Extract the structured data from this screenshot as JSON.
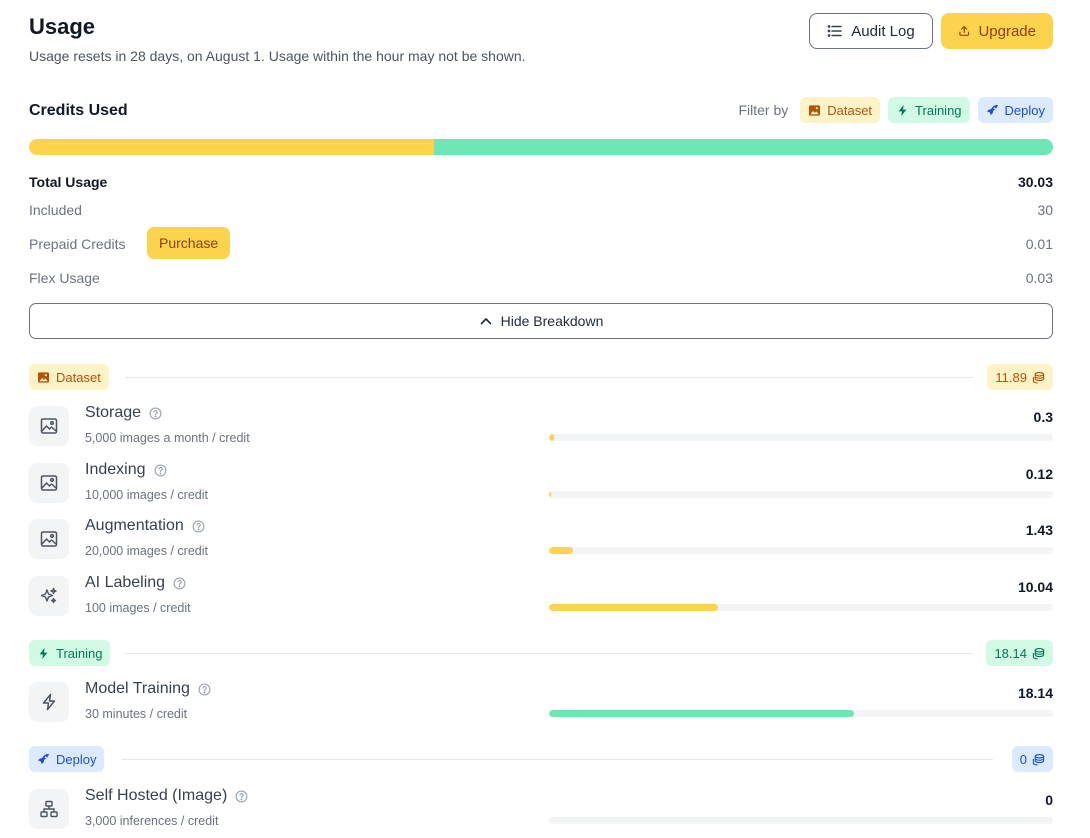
{
  "header": {
    "title": "Usage",
    "subtitle": "Usage resets in 28 days, on August 1. Usage within the hour may not be shown.",
    "audit_log_label": "Audit Log",
    "upgrade_label": "Upgrade"
  },
  "credits": {
    "title": "Credits Used",
    "filter_label": "Filter by",
    "filters": [
      "Dataset",
      "Training",
      "Deploy"
    ],
    "bar_segments": [
      {
        "category": "Dataset",
        "value": 11.89,
        "color": "#fcd34d"
      },
      {
        "category": "Training",
        "value": 18.14,
        "color": "#6ee7b7"
      }
    ],
    "total_label": "Total Usage",
    "total_value": "30.03",
    "included_label": "Included",
    "included_value": "30",
    "prepaid_label": "Prepaid Credits",
    "purchase_label": "Purchase",
    "prepaid_value": "0.01",
    "flex_label": "Flex Usage",
    "flex_value": "0.03",
    "breakdown_label": "Hide Breakdown"
  },
  "sections": {
    "dataset": {
      "label": "Dataset",
      "total": "11.89",
      "color": "#fcd34d",
      "items": [
        {
          "name": "Storage",
          "rate": "5,000 images a month / credit",
          "value": "0.3",
          "fill_fraction": 0.01,
          "icon": "image-icon"
        },
        {
          "name": "Indexing",
          "rate": "10,000 images / credit",
          "value": "0.12",
          "fill_fraction": 0.004,
          "icon": "image-icon"
        },
        {
          "name": "Augmentation",
          "rate": "20,000 images / credit",
          "value": "1.43",
          "fill_fraction": 0.048,
          "icon": "image-icon"
        },
        {
          "name": "AI Labeling",
          "rate": "100 images / credit",
          "value": "10.04",
          "fill_fraction": 0.335,
          "icon": "sparkles-icon"
        }
      ]
    },
    "training": {
      "label": "Training",
      "total": "18.14",
      "color": "#6ee7b7",
      "items": [
        {
          "name": "Model Training",
          "rate": "30 minutes / credit",
          "value": "18.14",
          "fill_fraction": 0.605,
          "icon": "lightning-icon"
        }
      ]
    },
    "deploy": {
      "label": "Deploy",
      "total": "0",
      "color": "#93c5fd",
      "items": [
        {
          "name": "Self Hosted (Image)",
          "rate": "3,000 inferences / credit",
          "value": "0",
          "fill_fraction": 0,
          "icon": "network-icon"
        }
      ]
    }
  }
}
